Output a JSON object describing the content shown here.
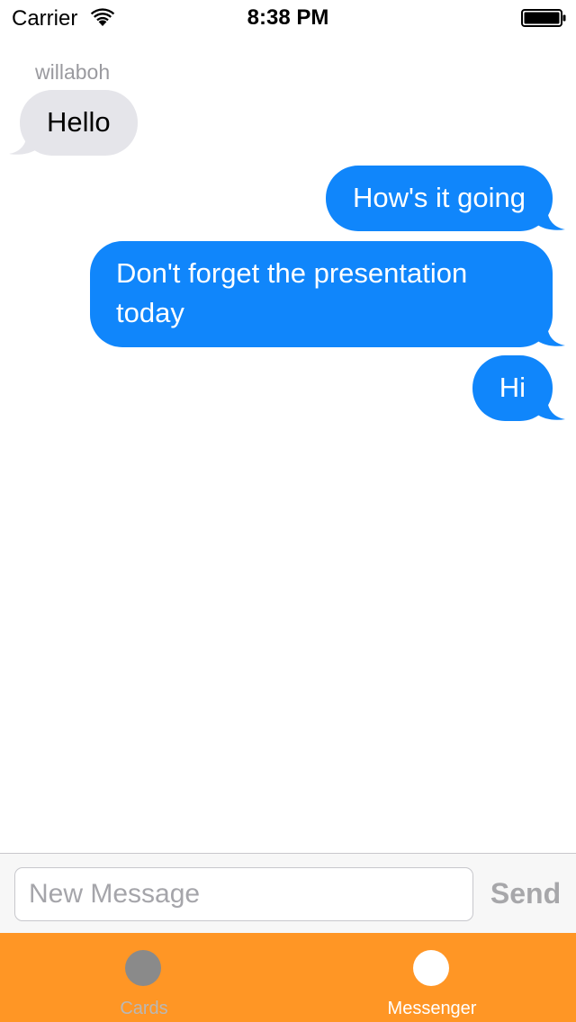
{
  "status_bar": {
    "carrier": "Carrier",
    "time": "8:38 PM",
    "wifi_icon": "wifi-icon",
    "battery_icon": "battery-icon"
  },
  "conversation": {
    "sender_name": "willaboh",
    "messages": [
      {
        "direction": "incoming",
        "text": "Hello"
      },
      {
        "direction": "outgoing",
        "text": "How's it going"
      },
      {
        "direction": "outgoing",
        "text": "Don't forget the presentation today"
      },
      {
        "direction": "outgoing",
        "text": "Hi"
      }
    ]
  },
  "composer": {
    "placeholder": "New Message",
    "value": "",
    "send_label": "Send"
  },
  "tab_bar": {
    "items": [
      {
        "label": "Cards",
        "icon": "circle-icon",
        "selected": false
      },
      {
        "label": "Messenger",
        "icon": "circle-icon",
        "selected": true
      }
    ]
  },
  "colors": {
    "incoming_bubble": "#e5e5ea",
    "outgoing_bubble": "#1086fb",
    "tab_bar_background": "#ff9625",
    "tab_selected": "#ffffff",
    "tab_unselected": "#8a8a8a"
  }
}
